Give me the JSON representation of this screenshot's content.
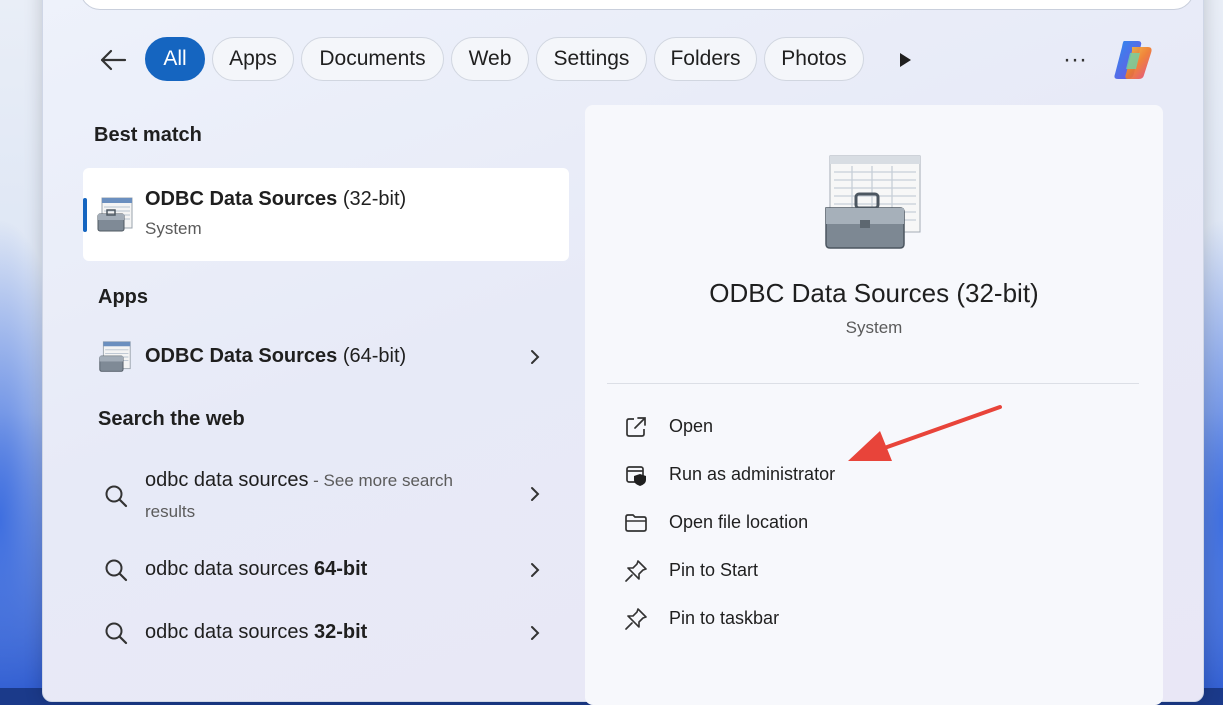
{
  "filters": {
    "items": [
      {
        "label": "All",
        "active": true
      },
      {
        "label": "Apps"
      },
      {
        "label": "Documents"
      },
      {
        "label": "Web"
      },
      {
        "label": "Settings"
      },
      {
        "label": "Folders"
      },
      {
        "label": "Photos"
      }
    ],
    "more_label": "···"
  },
  "best_match": {
    "heading": "Best match",
    "title_bold": "ODBC Data Sources",
    "title_suffix": " (32-bit)",
    "subtitle": "System"
  },
  "apps": {
    "heading": "Apps",
    "items": [
      {
        "title_bold": "ODBC Data Sources",
        "title_suffix": " (64-bit)"
      }
    ]
  },
  "web": {
    "heading": "Search the web",
    "items": [
      {
        "query": "odbc data sources",
        "suffix": " - See more search",
        "suffix2": "results"
      },
      {
        "query": "odbc data sources ",
        "bold": "64-bit"
      },
      {
        "query": "odbc data sources ",
        "bold": "32-bit"
      }
    ]
  },
  "detail": {
    "title": "ODBC Data Sources (32-bit)",
    "subtitle": "System",
    "actions": [
      {
        "label": "Open",
        "icon": "open-external-icon"
      },
      {
        "label": "Run as administrator",
        "icon": "shield-icon"
      },
      {
        "label": "Open file location",
        "icon": "folder-icon"
      },
      {
        "label": "Pin to Start",
        "icon": "pin-icon"
      },
      {
        "label": "Pin to taskbar",
        "icon": "pin-icon"
      }
    ]
  },
  "colors": {
    "accent": "#1565c0",
    "annotation_arrow": "#e8443a"
  }
}
